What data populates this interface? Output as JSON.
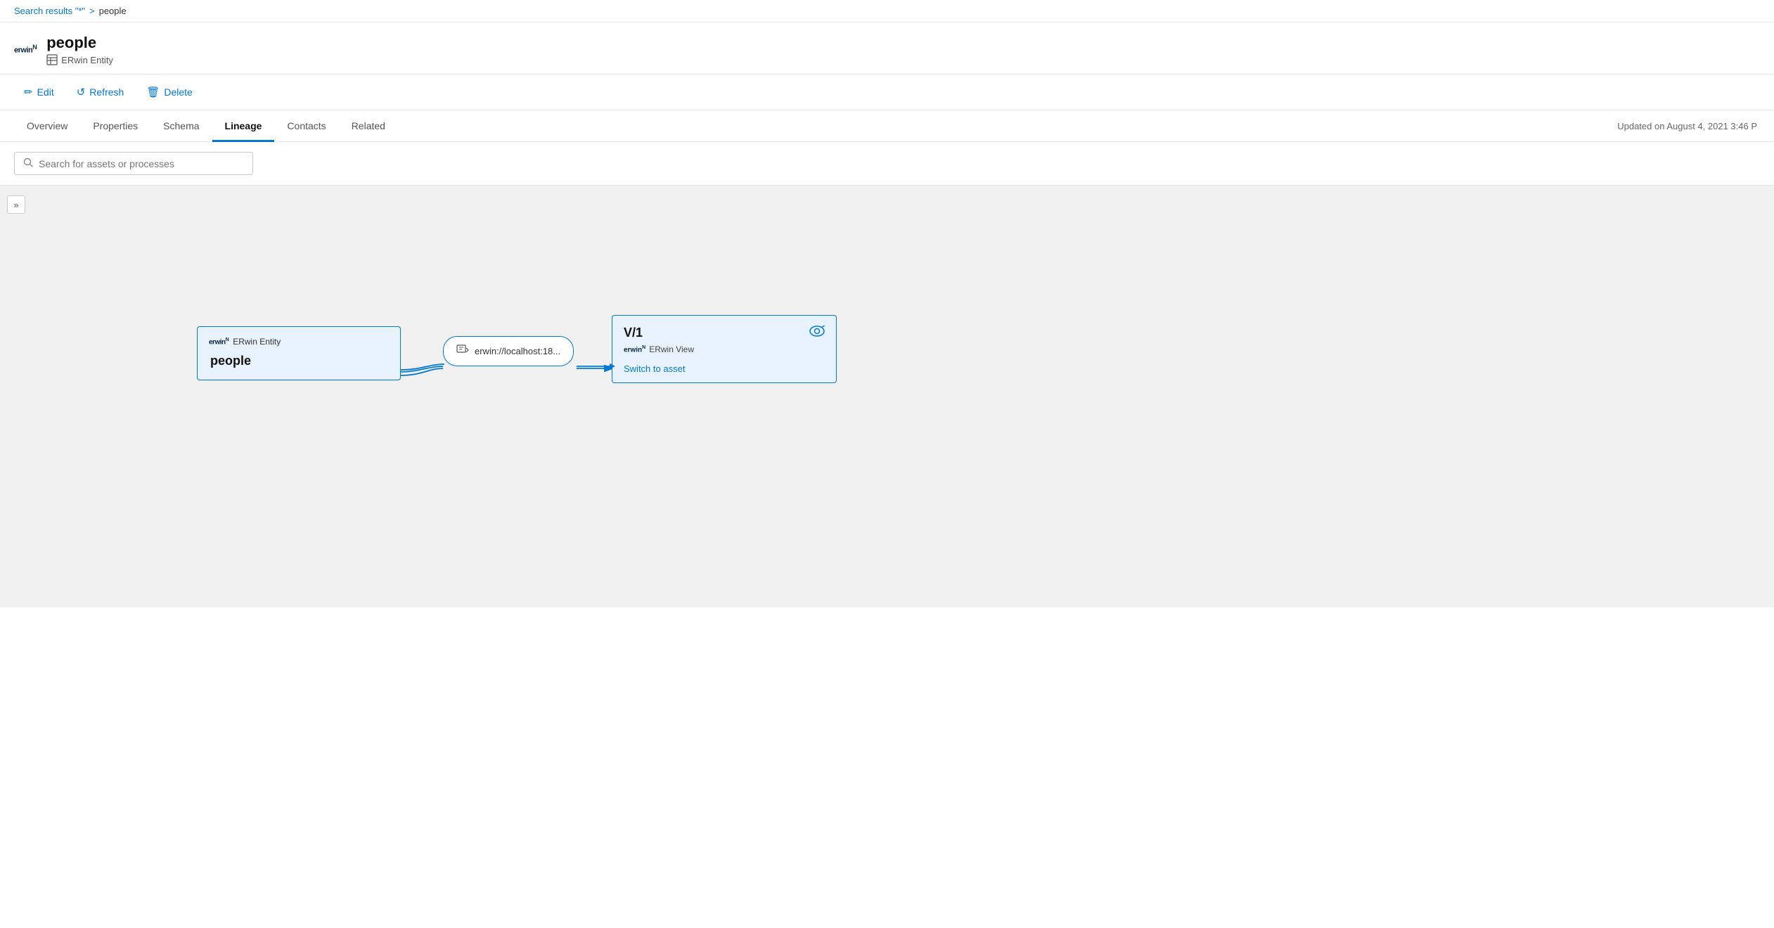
{
  "breadcrumb": {
    "search_link": "Search results \"*\"",
    "separator": ">",
    "current": "people"
  },
  "header": {
    "logo": "erwin",
    "title": "people",
    "subtitle_icon": "⊞",
    "subtitle_type": "ERwin Entity"
  },
  "toolbar": {
    "edit_label": "Edit",
    "refresh_label": "Refresh",
    "delete_label": "Delete",
    "edit_icon": "✏",
    "refresh_icon": "↺",
    "delete_icon": "🗑"
  },
  "tabs": {
    "items": [
      {
        "id": "overview",
        "label": "Overview"
      },
      {
        "id": "properties",
        "label": "Properties"
      },
      {
        "id": "schema",
        "label": "Schema"
      },
      {
        "id": "lineage",
        "label": "Lineage",
        "active": true
      },
      {
        "id": "contacts",
        "label": "Contacts"
      },
      {
        "id": "related",
        "label": "Related"
      }
    ],
    "updated_text": "Updated on August 4, 2021 3:46 P"
  },
  "search": {
    "placeholder": "Search for assets or processes"
  },
  "lineage": {
    "expand_icon": "»",
    "entity_node": {
      "logo": "erwin",
      "type": "ERwin Entity",
      "name": "people"
    },
    "process_node": {
      "label": "erwin://localhost:18..."
    },
    "view_node": {
      "title": "V/1",
      "type_logo": "erwin",
      "type_label": "ERwin View",
      "switch_link": "Switch to asset"
    }
  }
}
